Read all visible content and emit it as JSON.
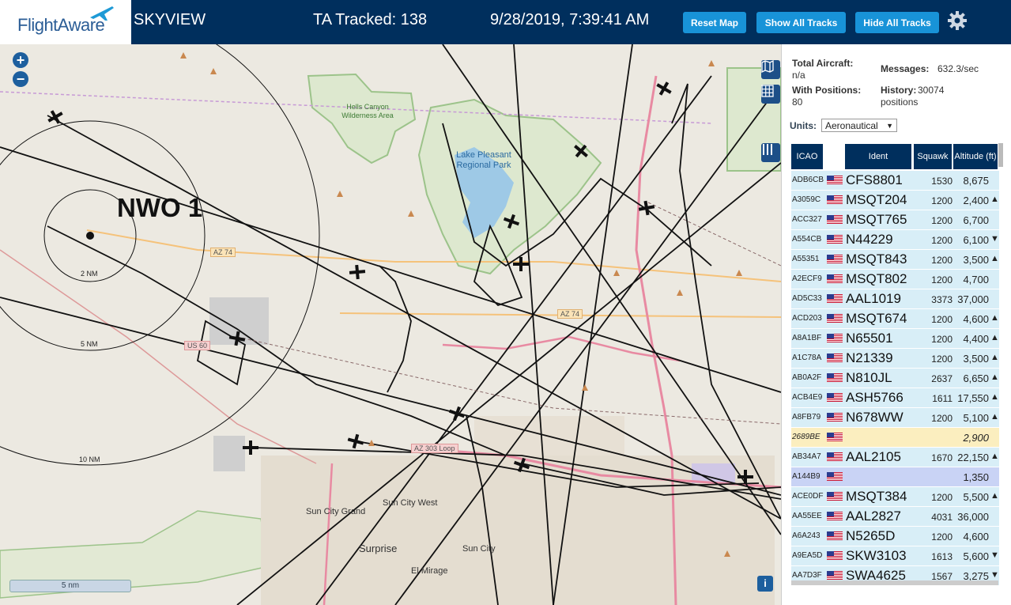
{
  "brand": {
    "logo_text": "FlightAware"
  },
  "header": {
    "app_name": "SKYVIEW",
    "ta_tracked": "TA Tracked: 138",
    "datetime": "9/28/2019, 7:39:41 AM",
    "buttons": {
      "reset": "Reset Map",
      "show_all": "Show All Tracks",
      "hide_all": "Hide All Tracks"
    }
  },
  "map": {
    "site_label": "NWO 1",
    "ring_labels": [
      "2 NM",
      "5 NM",
      "10 NM"
    ],
    "scale_label": "5 nm",
    "place_labels": [
      "Hells Canyon Wilderness Area",
      "Lake Pleasant Regional Park",
      "Sun City West",
      "Sun City Grand",
      "Surprise",
      "Sun City",
      "El Mirage"
    ],
    "road_labels": [
      "AZ 74",
      "AZ 74",
      "US 60",
      "AZ 303 Loop"
    ],
    "zoom_in": "+",
    "zoom_out": "−",
    "info": "i"
  },
  "stats": {
    "total_aircraft_label": "Total Aircraft:",
    "total_aircraft_value": "n/a",
    "with_positions_label": "With Positions:",
    "with_positions_value": "80",
    "messages_label": "Messages:",
    "messages_value": "632.3/sec",
    "history_label": "History:",
    "history_value": "30074 positions",
    "units_label": "Units:",
    "units_value": "Aeronautical"
  },
  "table": {
    "headers": [
      "ICAO",
      "Ident",
      "Squawk",
      "Altitude (ft)"
    ],
    "rows": [
      {
        "icao": "ADB6CB",
        "ident": "CFS8801",
        "squawk": "1530",
        "alt": "8,675",
        "trend": ""
      },
      {
        "icao": "A3059C",
        "ident": "MSQT204",
        "squawk": "1200",
        "alt": "2,400",
        "trend": "▲"
      },
      {
        "icao": "ACC327",
        "ident": "MSQT765",
        "squawk": "1200",
        "alt": "6,700",
        "trend": ""
      },
      {
        "icao": "A554CB",
        "ident": "N44229",
        "squawk": "1200",
        "alt": "6,100",
        "trend": "▼"
      },
      {
        "icao": "A55351",
        "ident": "MSQT843",
        "squawk": "1200",
        "alt": "3,500",
        "trend": "▲"
      },
      {
        "icao": "A2ECF9",
        "ident": "MSQT802",
        "squawk": "1200",
        "alt": "4,700",
        "trend": ""
      },
      {
        "icao": "AD5C33",
        "ident": "AAL1019",
        "squawk": "3373",
        "alt": "37,000",
        "trend": ""
      },
      {
        "icao": "ACD203",
        "ident": "MSQT674",
        "squawk": "1200",
        "alt": "4,600",
        "trend": "▲"
      },
      {
        "icao": "A8A1BF",
        "ident": "N65501",
        "squawk": "1200",
        "alt": "4,400",
        "trend": "▲"
      },
      {
        "icao": "A1C78A",
        "ident": "N21339",
        "squawk": "1200",
        "alt": "3,500",
        "trend": "▲"
      },
      {
        "icao": "AB0A2F",
        "ident": "N810JL",
        "squawk": "2637",
        "alt": "6,650",
        "trend": "▲"
      },
      {
        "icao": "ACB4E9",
        "ident": "ASH5766",
        "squawk": "1611",
        "alt": "17,550",
        "trend": "▲"
      },
      {
        "icao": "A8FB79",
        "ident": "N678WW",
        "squawk": "1200",
        "alt": "5,100",
        "trend": "▲"
      },
      {
        "icao": "2689BE",
        "ident": "",
        "squawk": "",
        "alt": "2,900",
        "trend": ""
      },
      {
        "icao": "AB34A7",
        "ident": "AAL2105",
        "squawk": "1670",
        "alt": "22,150",
        "trend": "▲"
      },
      {
        "icao": "A144B9",
        "ident": "",
        "squawk": "",
        "alt": "1,350",
        "trend": ""
      },
      {
        "icao": "ACE0DF",
        "ident": "MSQT384",
        "squawk": "1200",
        "alt": "5,500",
        "trend": "▲"
      },
      {
        "icao": "AA55EE",
        "ident": "AAL2827",
        "squawk": "4031",
        "alt": "36,000",
        "trend": ""
      },
      {
        "icao": "A6A243",
        "ident": "N5265D",
        "squawk": "1200",
        "alt": "4,600",
        "trend": ""
      },
      {
        "icao": "A9EA5D",
        "ident": "SKW3103",
        "squawk": "1613",
        "alt": "5,600",
        "trend": "▼"
      },
      {
        "icao": "AA7D3F",
        "ident": "SWA4625",
        "squawk": "1567",
        "alt": "3,275",
        "trend": "▼"
      }
    ]
  },
  "colors": {
    "topbar": "#002f5d",
    "button": "#1893d8",
    "row": "#d8eef7",
    "row_highlight": "#fbeebf",
    "row_selected": "#c9d3f5"
  }
}
